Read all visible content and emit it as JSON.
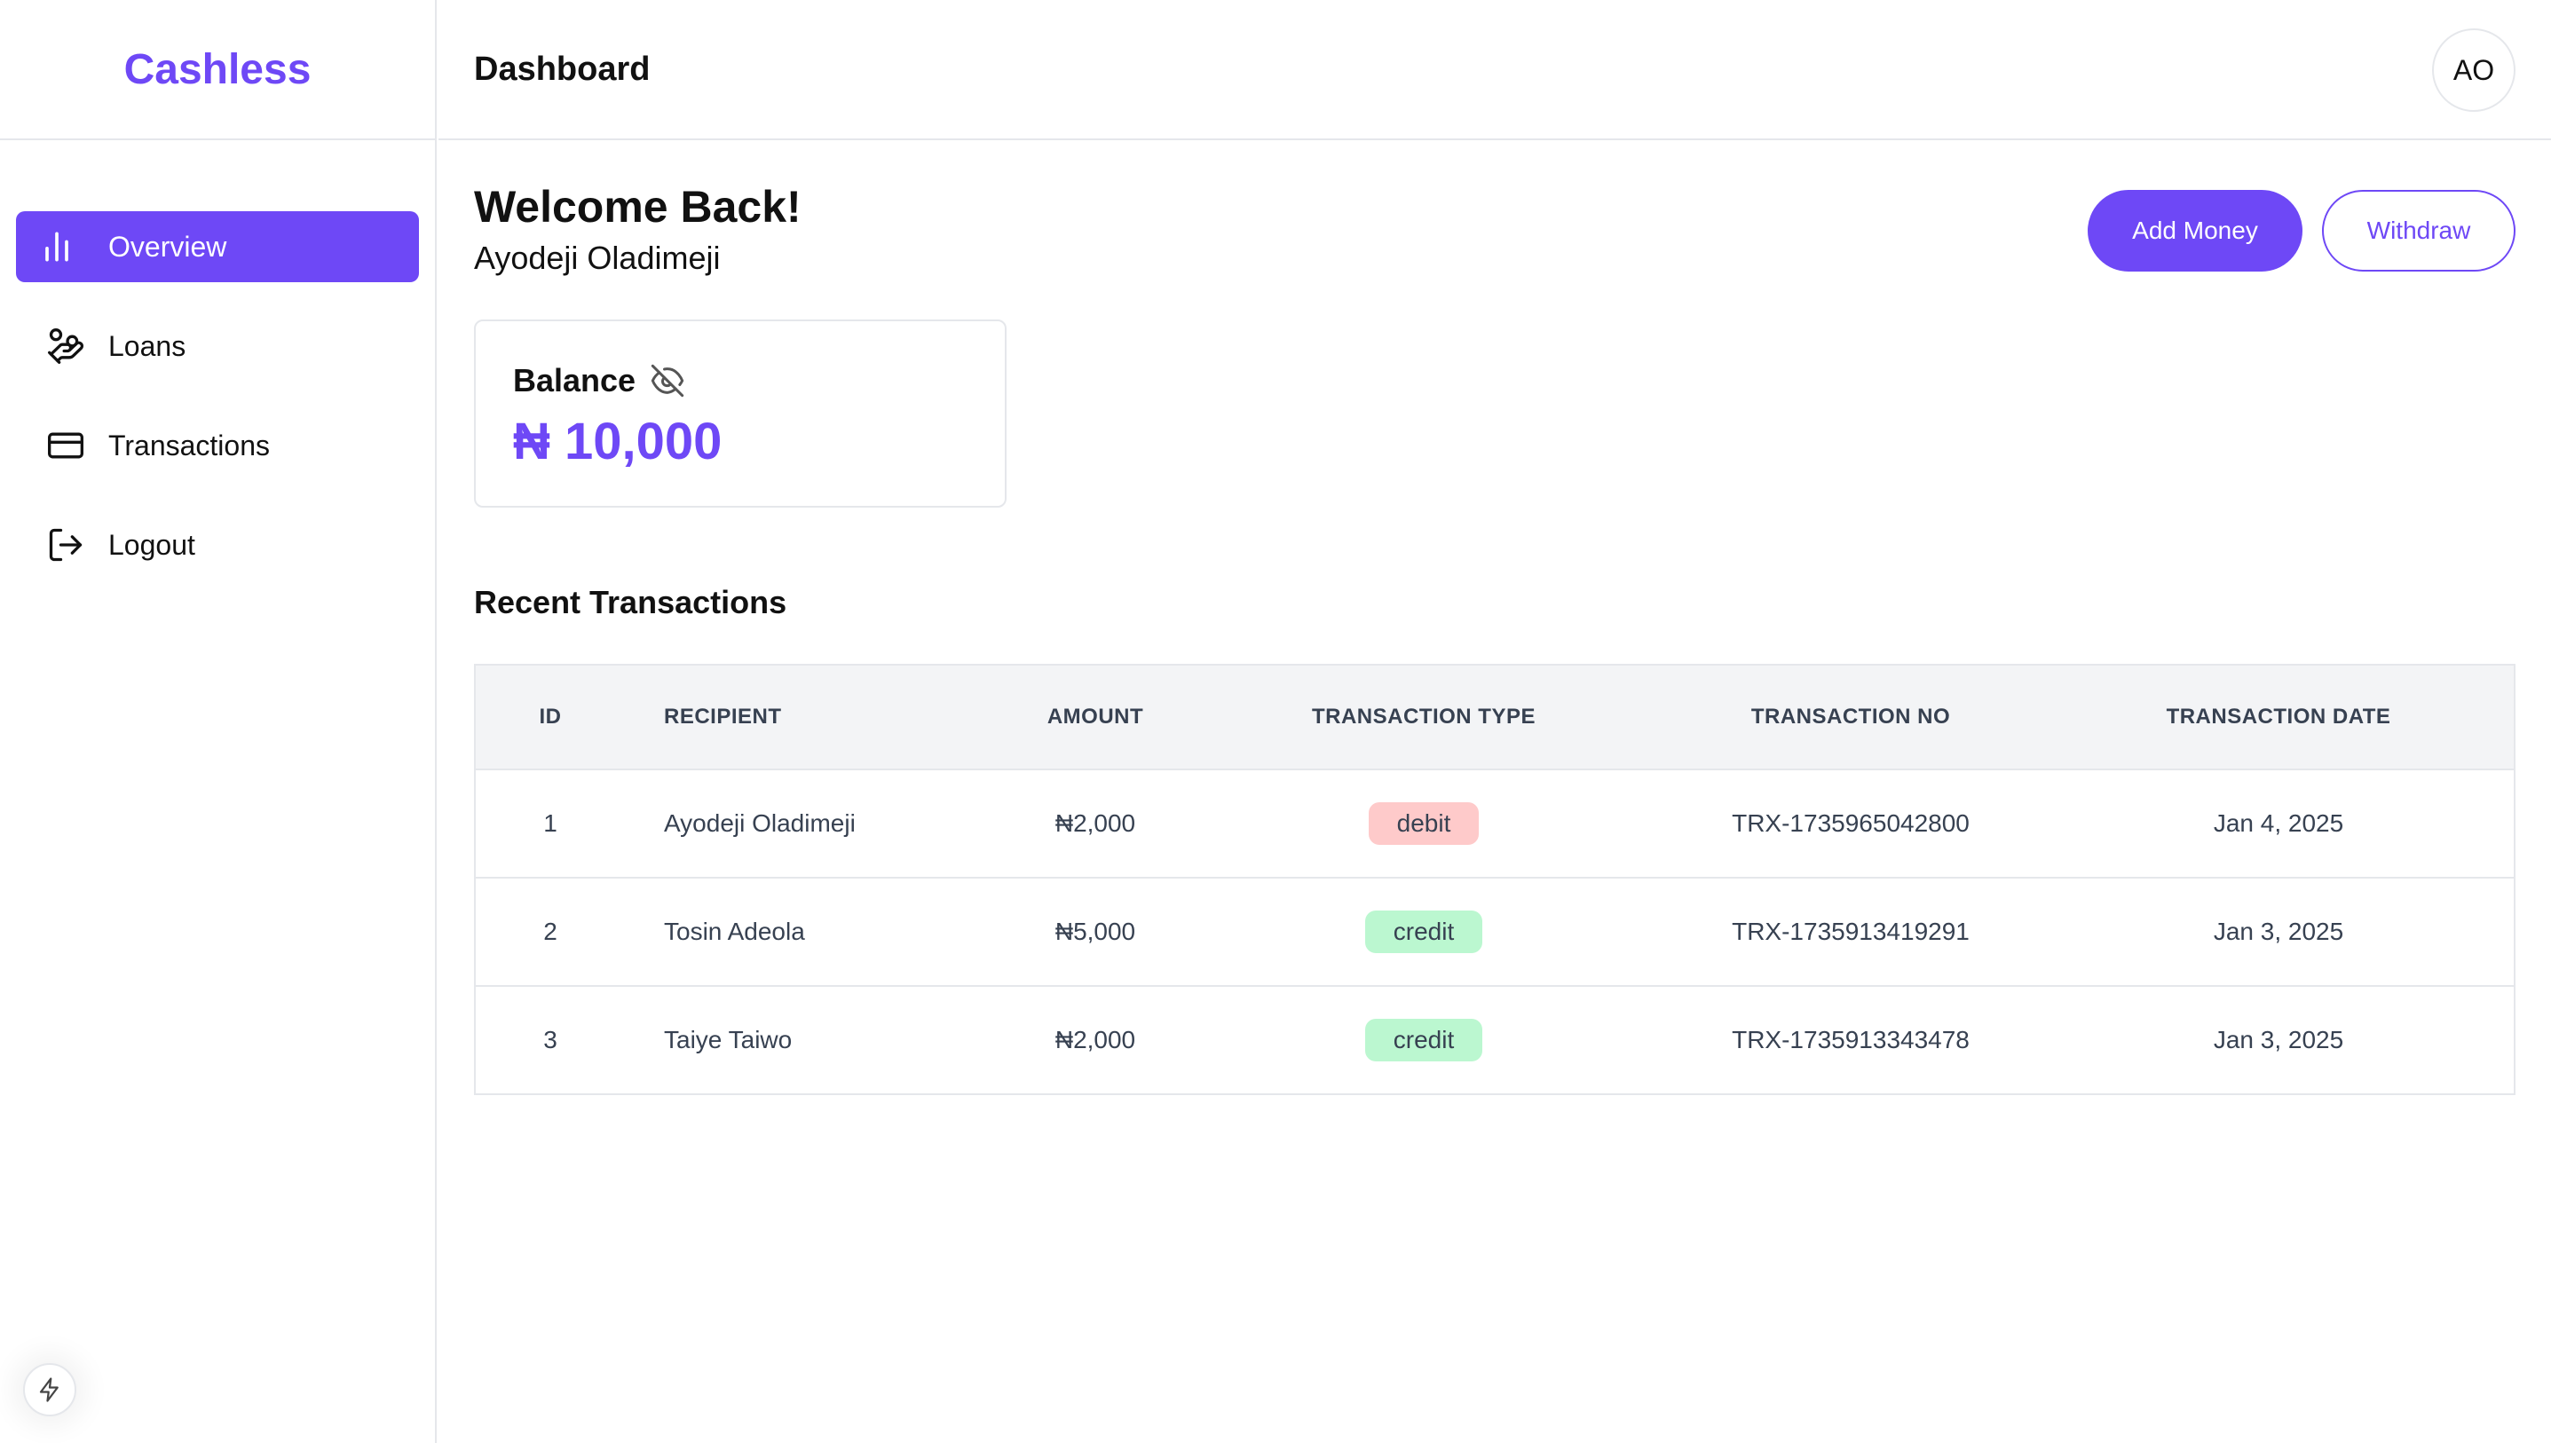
{
  "app": {
    "brand": "Cashless"
  },
  "sidebar": {
    "items": [
      {
        "label": "Overview",
        "icon": "bar-chart-icon",
        "active": true
      },
      {
        "label": "Loans",
        "icon": "hand-coins-icon",
        "active": false
      },
      {
        "label": "Transactions",
        "icon": "credit-card-icon",
        "active": false
      },
      {
        "label": "Logout",
        "icon": "logout-icon",
        "active": false
      }
    ]
  },
  "header": {
    "title": "Dashboard",
    "avatar_initials": "AO"
  },
  "main": {
    "welcome": "Welcome Back!",
    "user_name": "Ayodeji Oladimeji",
    "add_money_label": "Add Money",
    "withdraw_label": "Withdraw",
    "balance": {
      "label": "Balance",
      "amount": "₦ 10,000",
      "visibility_icon": "eye-off-icon"
    },
    "recent_title": "Recent Transactions",
    "table": {
      "headers": [
        "ID",
        "RECIPIENT",
        "AMOUNT",
        "TRANSACTION TYPE",
        "TRANSACTION NO",
        "TRANSACTION DATE"
      ],
      "rows": [
        {
          "id": "1",
          "recipient": "Ayodeji Oladimeji",
          "amount": "₦2,000",
          "type": "debit",
          "number": "TRX-1735965042800",
          "date": "Jan 4, 2025"
        },
        {
          "id": "2",
          "recipient": "Tosin Adeola",
          "amount": "₦5,000",
          "type": "credit",
          "number": "TRX-1735913419291",
          "date": "Jan 3, 2025"
        },
        {
          "id": "3",
          "recipient": "Taiye Taiwo",
          "amount": "₦2,000",
          "type": "credit",
          "number": "TRX-1735913343478",
          "date": "Jan 3, 2025"
        }
      ]
    }
  },
  "colors": {
    "accent": "#6e48f6",
    "debit_bg": "#fecaca",
    "credit_bg": "#bbf7d0",
    "border": "#e5e7eb",
    "table_header_bg": "#f3f4f6"
  }
}
